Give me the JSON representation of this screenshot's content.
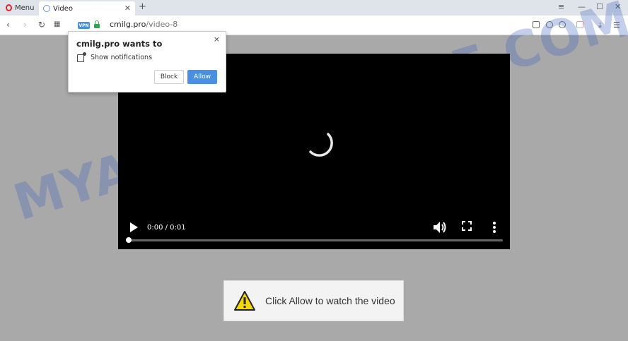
{
  "browser": {
    "menu_label": "Menu",
    "tab_title": "Video",
    "url_domain": "cmilg.pro",
    "url_path": "/video-8",
    "vpn_badge": "VPN"
  },
  "notification_popup": {
    "title": "cmilg.pro wants to",
    "permission": "Show notifications",
    "block_label": "Block",
    "allow_label": "Allow",
    "close_glyph": "×"
  },
  "video": {
    "time": "0:00 / 0:01",
    "progress": 0
  },
  "banner": {
    "message": "Click Allow to watch the video",
    "icon": "warning-icon"
  },
  "watermark": "MYANTISPYWARE.COM",
  "colors": {
    "allow_button": "#4a90e2",
    "warning_yellow": "#f5d800",
    "page_background": "#a9a9a9"
  }
}
